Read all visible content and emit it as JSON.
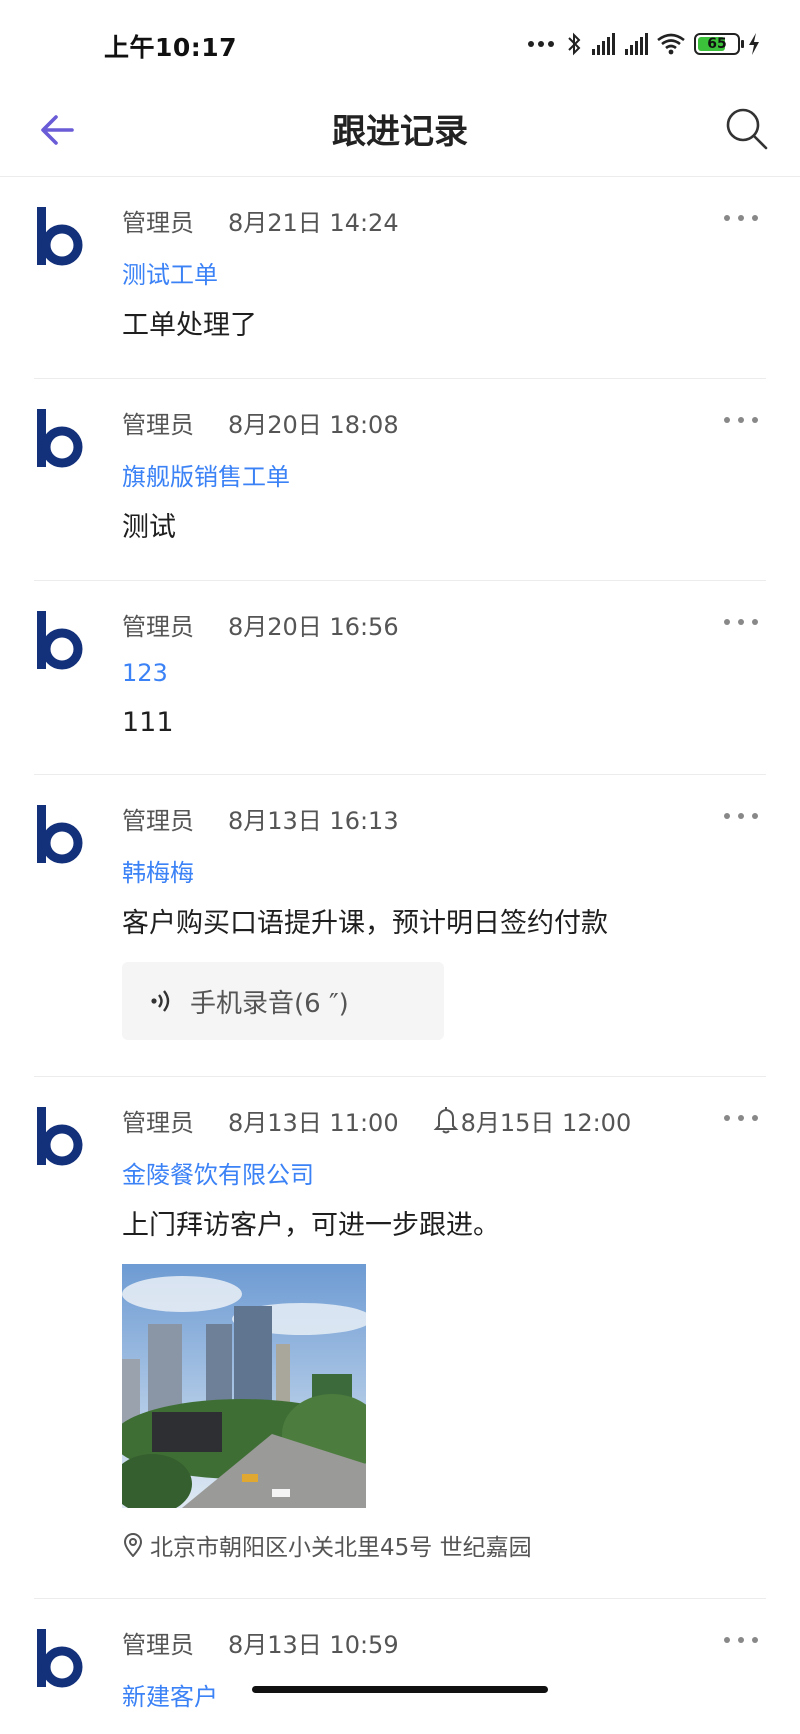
{
  "status_bar": {
    "time": "上午10:17",
    "battery_level": "65"
  },
  "nav": {
    "title": "跟进记录",
    "back_icon": "arrow-left-icon",
    "search_icon": "search-icon",
    "accent": "#6a5bd6"
  },
  "colors": {
    "link": "#3b82f6",
    "avatar": "#13307a"
  },
  "records": [
    {
      "author": "管理员",
      "time": "8月21日 14:24",
      "link": "测试工单",
      "content": "工单处理了"
    },
    {
      "author": "管理员",
      "time": "8月20日 18:08",
      "link": "旗舰版销售工单",
      "content": "测试"
    },
    {
      "author": "管理员",
      "time": "8月20日 16:56",
      "link": "123",
      "content": "111"
    },
    {
      "author": "管理员",
      "time": "8月13日 16:13",
      "link": "韩梅梅",
      "content": "客户购买口语提升课，预计明日签约付款",
      "audio": "手机录音(6 ″)"
    },
    {
      "author": "管理员",
      "time": "8月13日 11:00",
      "reminder": "8月15日 12:00",
      "link": "金陵餐饮有限公司",
      "content": "上门拜访客户，可进一步跟进。",
      "location": "北京市朝阳区小关北里45号 世纪嘉园"
    },
    {
      "author": "管理员",
      "time": "8月13日 10:59",
      "link": "新建客户"
    }
  ]
}
